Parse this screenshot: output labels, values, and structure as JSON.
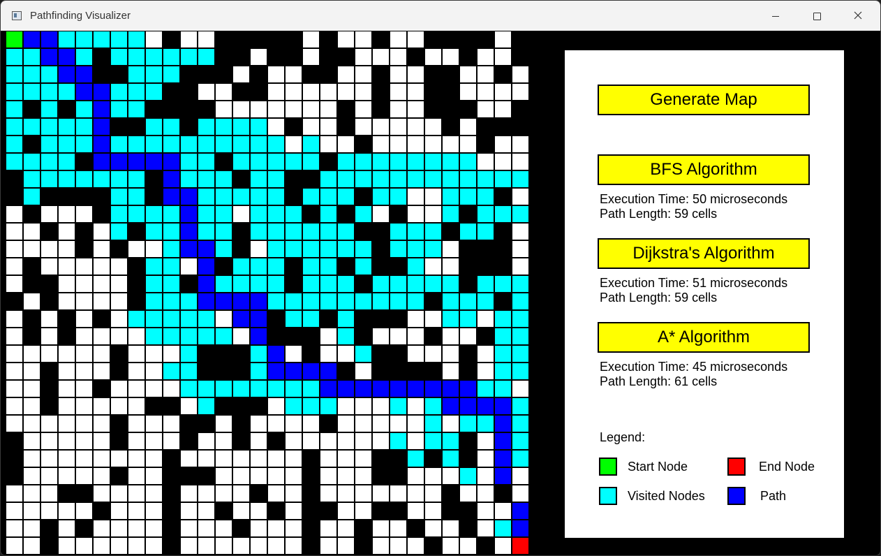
{
  "window": {
    "title": "Pathfinding Visualizer"
  },
  "grid": {
    "rows": 30,
    "cols": 30,
    "legend_key": {
      "S": "start",
      "E": "end",
      "W": "wall",
      "V": "visited",
      "P": "path",
      ".": "empty"
    },
    "colors": {
      "S": "#00ff00",
      "E": "#ff0000",
      "W": "#000000",
      "V": "#00ffff",
      "P": "#0000ff",
      ".": "#ffffff"
    },
    "cells": [
      "SPPVVVVV.W..WWWWW.W..W..WWWW.W",
      "VVPPVWVVVVVVWW.WW.WW...W..W..W",
      "VVVPPWWVVVWWW.W..WW..W..WW..W.",
      "VVVVPPVVVWW..WW......W..WW....",
      "VWVWVPVVWWWW.......W.W..WWW..W",
      "VVVVVPWWVVWVVVV.W..W.....W.WWW",
      "VWVVVPVVVVVVVVVV.V..W......W..",
      "VVVVWPPPPPVVWVVVVVWVVVVVVVV...",
      "WVVVVVVVWPVVVWVVWWVVVVVVVVVVVV",
      "WVWWWWVVWPPVVVVVWVVVWVV..VVVW.",
      ".W...WVVVVPVV.VVVWVWV.W..VWVVVV",
      "..W.W.VWVVPVVWVVVVVVWWVVVWVVW.",
      "....W.W..VPPVW.VVVVVVWVVV.WWW.",
      ".W.....WVV.PWVVVWVVWVWWV..WWW.",
      ".WW....WVVWPVVVVWVVVWVVVVVWVVV",
      "W.W....WVVVPPPPVVVVVVVVVWVVVWV",
      ".W.W.W.VVVVV.PPWVVWVWWW..VV.VV",
      ".W.W....VVVVV.PWWW.VW...W..WVV",
      "......W...VWWWVP.W..VWW...W.VV",
      "..W...W..VVWWWVPPPPW.WWWW.W.VV",
      "..W..W....VVVVVVVVPPPPPPPPPVV.",
      "..W.....WW.VWWW.VVV...V.VPPPPV",
      "......W...WW.W....W.....V.VVPV",
      "W.....W...W..W.W......V.VVW.PV",
      "W........W.......W...WWVWVW.PV",
      "W.....W..WWW.....W...WW...V.P.",
      "...WW....W....W..W.......W..W.",
      ".....W...W..W..W.WW..WW..WW..P",
      "..W.W....W...W...W..W..W..W.VP",
      "..W......W.......W..W...W..W.E"
    ]
  },
  "panel": {
    "generate_label": "Generate Map",
    "bfs": {
      "label": "BFS Algorithm",
      "time": "Execution Time: 50 microseconds",
      "length": "Path Length: 59 cells"
    },
    "dijkstra": {
      "label": "Dijkstra's Algorithm",
      "time": "Execution Time: 51 microseconds",
      "length": "Path Length: 59 cells"
    },
    "astar": {
      "label": "A* Algorithm",
      "time": "Execution Time: 45 microseconds",
      "length": "Path Length: 61 cells"
    },
    "legend": {
      "title": "Legend:",
      "start": "Start Node",
      "end": "End Node",
      "visited": "Visited Nodes",
      "path": "Path"
    }
  }
}
